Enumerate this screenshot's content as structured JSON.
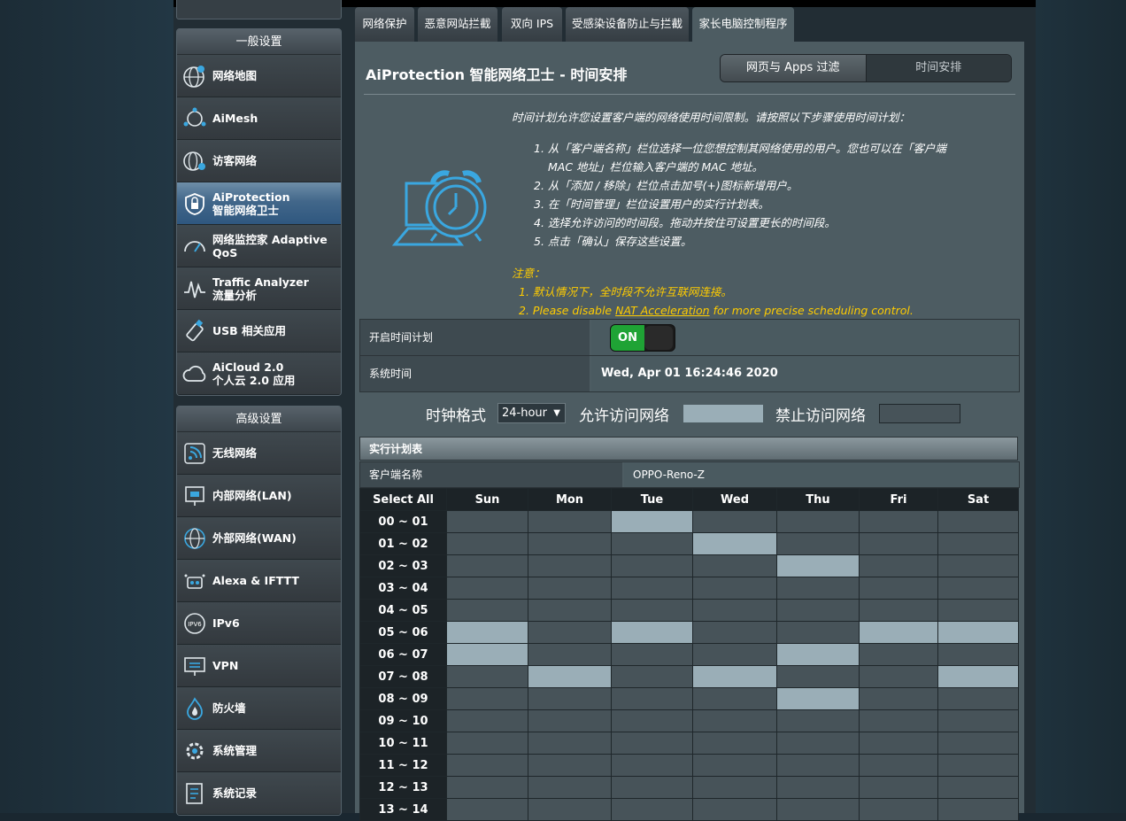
{
  "sidebar": {
    "general_title": "一般设置",
    "general_items": [
      {
        "label": "网络地图",
        "icon": "globe-map-icon"
      },
      {
        "label": "AiMesh",
        "icon": "aimesh-icon"
      },
      {
        "label": "访客网络",
        "icon": "guest-network-icon"
      },
      {
        "label": "AiProtection\n智能网络卫士",
        "icon": "shield-lock-icon",
        "active": true
      },
      {
        "label": "网络监控家 Adaptive\nQoS",
        "icon": "speedometer-icon"
      },
      {
        "label": "Traffic Analyzer\n流量分析",
        "icon": "traffic-wave-icon"
      },
      {
        "label": "USB 相关应用",
        "icon": "usb-icon"
      },
      {
        "label": "AiCloud 2.0\n个人云 2.0 应用",
        "icon": "cloud-icon"
      }
    ],
    "advanced_title": "高级设置",
    "advanced_items": [
      {
        "label": "无线网络",
        "icon": "wireless-icon"
      },
      {
        "label": "内部网络(LAN)",
        "icon": "lan-icon"
      },
      {
        "label": "外部网络(WAN)",
        "icon": "wan-globe-icon"
      },
      {
        "label": "Alexa & IFTTT",
        "icon": "alexa-icon"
      },
      {
        "label": "IPv6",
        "icon": "ipv6-icon"
      },
      {
        "label": "VPN",
        "icon": "vpn-icon"
      },
      {
        "label": "防火墙",
        "icon": "firewall-icon"
      },
      {
        "label": "系统管理",
        "icon": "gear-icon"
      },
      {
        "label": "系统记录",
        "icon": "log-icon"
      }
    ]
  },
  "tabs": [
    {
      "label": "网络保护"
    },
    {
      "label": "恶意网站拦截"
    },
    {
      "label": "双向 IPS"
    },
    {
      "label": "受感染设备防止与拦截"
    },
    {
      "label": "家长电脑控制程序",
      "active": true
    }
  ],
  "panel": {
    "title": "AiProtection 智能网络卫士 - 时间安排",
    "seg_left": "网页与 Apps 过滤",
    "seg_right": "时间安排",
    "description": "时间计划允许您设置客户端的网络使用时间限制。请按照以下步骤使用时间计划：",
    "steps": [
      "1. 从「客户端名称」栏位选择一位您想控制其网络使用的用户。您也可以在「客户端",
      "MAC 地址」栏位输入客户端的 MAC 地址。",
      "2. 从「添加 / 移除」栏位点击加号(+)图标新增用户。",
      "3. 在「时间管理」栏位设置用户的实行计划表。",
      "4. 选择允许访问的时间段。拖动并按住可设置更长的时间段。",
      "5. 点击「确认」保存这些设置。"
    ],
    "note_title": "注意：",
    "note_1": "1. 默认情况下，全时段不允许互联网连接。",
    "note_2_pre": "2. Please disable ",
    "note_2_link": "NAT Acceleration",
    "note_2_post": " for more precise scheduling control.",
    "enable_label": "开启时间计划",
    "toggle_on": "ON",
    "systime_label": "系统时间",
    "systime_value": "Wed, Apr 01 16:24:46 2020",
    "clock_format_label": "时钟格式",
    "clock_format_value": "24-hour",
    "allow_label": "允许访问网络",
    "deny_label": "禁止访问网络",
    "schedule_header": "实行计划表",
    "client_label": "客户端名称",
    "client_value": "OPPO-Reno-Z"
  },
  "colors": {
    "allowed": "#9aaeb7",
    "denied": "#475359",
    "toggle_on": "#1fa335"
  },
  "schedule": {
    "select_all": "Select All",
    "days": [
      "Sun",
      "Mon",
      "Tue",
      "Wed",
      "Thu",
      "Fri",
      "Sat"
    ],
    "rows": [
      {
        "hour": "00 ~ 01",
        "cells": [
          0,
          0,
          1,
          0,
          0,
          0,
          0
        ]
      },
      {
        "hour": "01 ~ 02",
        "cells": [
          0,
          0,
          0,
          1,
          0,
          0,
          0
        ]
      },
      {
        "hour": "02 ~ 03",
        "cells": [
          0,
          0,
          0,
          0,
          1,
          0,
          0
        ]
      },
      {
        "hour": "03 ~ 04",
        "cells": [
          0,
          0,
          0,
          0,
          0,
          0,
          0
        ]
      },
      {
        "hour": "04 ~ 05",
        "cells": [
          0,
          0,
          0,
          0,
          0,
          0,
          0
        ]
      },
      {
        "hour": "05 ~ 06",
        "cells": [
          1,
          0,
          1,
          0,
          0,
          1,
          1
        ]
      },
      {
        "hour": "06 ~ 07",
        "cells": [
          1,
          0,
          0,
          0,
          1,
          0,
          0
        ]
      },
      {
        "hour": "07 ~ 08",
        "cells": [
          0,
          1,
          0,
          1,
          0,
          0,
          1
        ]
      },
      {
        "hour": "08 ~ 09",
        "cells": [
          0,
          0,
          0,
          0,
          1,
          0,
          0
        ]
      },
      {
        "hour": "09 ~ 10",
        "cells": [
          0,
          0,
          0,
          0,
          0,
          0,
          0
        ]
      },
      {
        "hour": "10 ~ 11",
        "cells": [
          0,
          0,
          0,
          0,
          0,
          0,
          0
        ]
      },
      {
        "hour": "11 ~ 12",
        "cells": [
          0,
          0,
          0,
          0,
          0,
          0,
          0
        ]
      },
      {
        "hour": "12 ~ 13",
        "cells": [
          0,
          0,
          0,
          0,
          0,
          0,
          0
        ]
      },
      {
        "hour": "13 ~ 14",
        "cells": [
          0,
          0,
          0,
          0,
          0,
          0,
          0
        ]
      }
    ]
  }
}
